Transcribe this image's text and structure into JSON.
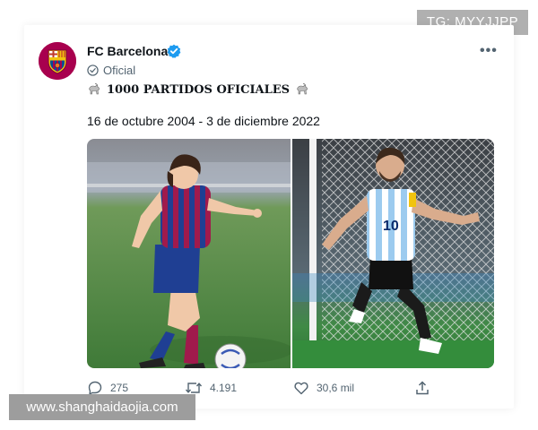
{
  "watermarks": {
    "top": "TG: MYYJJPP",
    "bottom": "www.shanghaidaojia.com"
  },
  "tweet": {
    "author_name": "FC Barcelona",
    "badge": "Oficial",
    "headline": "1000 PARTIDOS OFICIALES",
    "dates": "16 de octubre 2004 - 3 de diciembre 2022",
    "actions": {
      "replies": "275",
      "retweets": "4.191",
      "likes": "30,6 mil"
    }
  },
  "icons": [
    "verified-icon",
    "more-options-icon",
    "check-circle-icon",
    "goat-icon",
    "reply-icon",
    "retweet-icon",
    "like-icon",
    "share-icon"
  ],
  "colors": {
    "verified": "#1d9bf0",
    "barca_maroon": "#a8004e",
    "barca_blue": "#004d98",
    "muted": "#536471"
  }
}
